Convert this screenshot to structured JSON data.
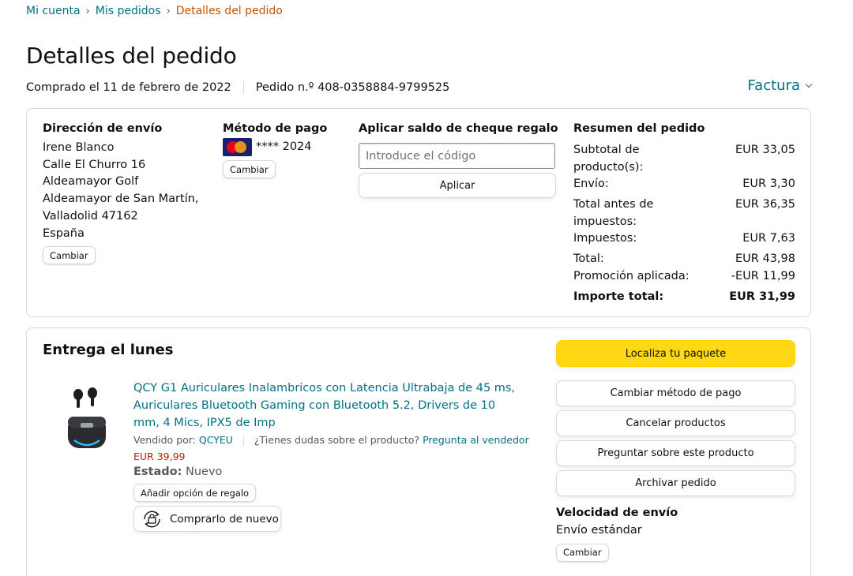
{
  "breadcrumb": {
    "items": [
      "Mi cuenta",
      "Mis pedidos"
    ],
    "current": "Detalles del pedido"
  },
  "page_title": "Detalles del pedido",
  "order_meta": {
    "purchased": "Comprado el 11 de febrero de 2022",
    "order_number": "Pedido n.º 408-0358884-9799525"
  },
  "invoice_label": "Factura",
  "shipping_address": {
    "heading": "Dirección de envío",
    "lines": [
      "Irene Blanco",
      "Calle El Churro 16",
      "Aldeamayor Golf",
      "Aldeamayor de San Martín,",
      "Valladolid 47162",
      "España"
    ],
    "change_label": "Cambiar"
  },
  "payment_method": {
    "heading": "Método de pago",
    "card_icon": "mastercard-icon",
    "card_text": "**** 2024",
    "change_label": "Cambiar"
  },
  "gift_card": {
    "heading": "Aplicar saldo de cheque regalo",
    "placeholder": "Introduce el código",
    "apply_label": "Aplicar"
  },
  "order_summary": {
    "heading": "Resumen del pedido",
    "rows": [
      {
        "label": "Subtotal de producto(s):",
        "value": "EUR 33,05"
      },
      {
        "label": "Envío:",
        "value": "EUR 3,30"
      },
      {
        "label": "Total antes de impuestos:",
        "value": "EUR 36,35"
      },
      {
        "label": "Impuestos:",
        "value": "EUR 7,63"
      },
      {
        "label": "Total:",
        "value": "EUR 43,98"
      },
      {
        "label": "Promoción aplicada:",
        "value": "-EUR 11,99"
      }
    ],
    "grand_total": {
      "label": "Importe total:",
      "value": "EUR 31,99"
    }
  },
  "delivery": {
    "heading": "Entrega el lunes",
    "product": {
      "title": "QCY G1 Auriculares Inalambricos con Latencia Ultrabaja de 45 ms, Auriculares Bluetooth Gaming con Bluetooth 5.2, Drivers de 10 mm, 4 Mics, IPX5 de Imp",
      "sold_by_label": "Vendido por:",
      "seller": "QCYEU",
      "question_label": "¿Tienes dudas sobre el producto?",
      "ask_seller": "Pregunta al vendedor",
      "price": "EUR 39,99",
      "state_label": "Estado:",
      "state_value": "Nuevo",
      "gift_option": "Añadir opción de regalo",
      "buy_again": "Comprarlo de nuevo"
    },
    "actions": {
      "track": "Localiza tu paquete",
      "change_payment": "Cambiar método de pago",
      "cancel": "Cancelar productos",
      "ask": "Preguntar sobre este producto",
      "archive": "Archivar pedido"
    },
    "shipping_speed": {
      "heading": "Velocidad de envío",
      "value": "Envío estándar",
      "change_label": "Cambiar"
    }
  },
  "colors": {
    "link": "#007185",
    "breadcrumb_current": "#c45500",
    "price": "#b12704",
    "primary_button": "#ffd814"
  }
}
